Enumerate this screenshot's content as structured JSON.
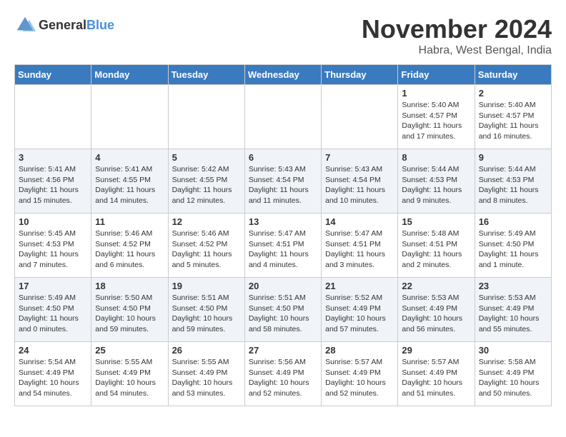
{
  "header": {
    "logo_general": "General",
    "logo_blue": "Blue",
    "month": "November 2024",
    "location": "Habra, West Bengal, India"
  },
  "weekdays": [
    "Sunday",
    "Monday",
    "Tuesday",
    "Wednesday",
    "Thursday",
    "Friday",
    "Saturday"
  ],
  "weeks": [
    [
      {
        "day": "",
        "content": ""
      },
      {
        "day": "",
        "content": ""
      },
      {
        "day": "",
        "content": ""
      },
      {
        "day": "",
        "content": ""
      },
      {
        "day": "",
        "content": ""
      },
      {
        "day": "1",
        "content": "Sunrise: 5:40 AM\nSunset: 4:57 PM\nDaylight: 11 hours and 17 minutes."
      },
      {
        "day": "2",
        "content": "Sunrise: 5:40 AM\nSunset: 4:57 PM\nDaylight: 11 hours and 16 minutes."
      }
    ],
    [
      {
        "day": "3",
        "content": "Sunrise: 5:41 AM\nSunset: 4:56 PM\nDaylight: 11 hours and 15 minutes."
      },
      {
        "day": "4",
        "content": "Sunrise: 5:41 AM\nSunset: 4:55 PM\nDaylight: 11 hours and 14 minutes."
      },
      {
        "day": "5",
        "content": "Sunrise: 5:42 AM\nSunset: 4:55 PM\nDaylight: 11 hours and 12 minutes."
      },
      {
        "day": "6",
        "content": "Sunrise: 5:43 AM\nSunset: 4:54 PM\nDaylight: 11 hours and 11 minutes."
      },
      {
        "day": "7",
        "content": "Sunrise: 5:43 AM\nSunset: 4:54 PM\nDaylight: 11 hours and 10 minutes."
      },
      {
        "day": "8",
        "content": "Sunrise: 5:44 AM\nSunset: 4:53 PM\nDaylight: 11 hours and 9 minutes."
      },
      {
        "day": "9",
        "content": "Sunrise: 5:44 AM\nSunset: 4:53 PM\nDaylight: 11 hours and 8 minutes."
      }
    ],
    [
      {
        "day": "10",
        "content": "Sunrise: 5:45 AM\nSunset: 4:53 PM\nDaylight: 11 hours and 7 minutes."
      },
      {
        "day": "11",
        "content": "Sunrise: 5:46 AM\nSunset: 4:52 PM\nDaylight: 11 hours and 6 minutes."
      },
      {
        "day": "12",
        "content": "Sunrise: 5:46 AM\nSunset: 4:52 PM\nDaylight: 11 hours and 5 minutes."
      },
      {
        "day": "13",
        "content": "Sunrise: 5:47 AM\nSunset: 4:51 PM\nDaylight: 11 hours and 4 minutes."
      },
      {
        "day": "14",
        "content": "Sunrise: 5:47 AM\nSunset: 4:51 PM\nDaylight: 11 hours and 3 minutes."
      },
      {
        "day": "15",
        "content": "Sunrise: 5:48 AM\nSunset: 4:51 PM\nDaylight: 11 hours and 2 minutes."
      },
      {
        "day": "16",
        "content": "Sunrise: 5:49 AM\nSunset: 4:50 PM\nDaylight: 11 hours and 1 minute."
      }
    ],
    [
      {
        "day": "17",
        "content": "Sunrise: 5:49 AM\nSunset: 4:50 PM\nDaylight: 11 hours and 0 minutes."
      },
      {
        "day": "18",
        "content": "Sunrise: 5:50 AM\nSunset: 4:50 PM\nDaylight: 10 hours and 59 minutes."
      },
      {
        "day": "19",
        "content": "Sunrise: 5:51 AM\nSunset: 4:50 PM\nDaylight: 10 hours and 59 minutes."
      },
      {
        "day": "20",
        "content": "Sunrise: 5:51 AM\nSunset: 4:50 PM\nDaylight: 10 hours and 58 minutes."
      },
      {
        "day": "21",
        "content": "Sunrise: 5:52 AM\nSunset: 4:49 PM\nDaylight: 10 hours and 57 minutes."
      },
      {
        "day": "22",
        "content": "Sunrise: 5:53 AM\nSunset: 4:49 PM\nDaylight: 10 hours and 56 minutes."
      },
      {
        "day": "23",
        "content": "Sunrise: 5:53 AM\nSunset: 4:49 PM\nDaylight: 10 hours and 55 minutes."
      }
    ],
    [
      {
        "day": "24",
        "content": "Sunrise: 5:54 AM\nSunset: 4:49 PM\nDaylight: 10 hours and 54 minutes."
      },
      {
        "day": "25",
        "content": "Sunrise: 5:55 AM\nSunset: 4:49 PM\nDaylight: 10 hours and 54 minutes."
      },
      {
        "day": "26",
        "content": "Sunrise: 5:55 AM\nSunset: 4:49 PM\nDaylight: 10 hours and 53 minutes."
      },
      {
        "day": "27",
        "content": "Sunrise: 5:56 AM\nSunset: 4:49 PM\nDaylight: 10 hours and 52 minutes."
      },
      {
        "day": "28",
        "content": "Sunrise: 5:57 AM\nSunset: 4:49 PM\nDaylight: 10 hours and 52 minutes."
      },
      {
        "day": "29",
        "content": "Sunrise: 5:57 AM\nSunset: 4:49 PM\nDaylight: 10 hours and 51 minutes."
      },
      {
        "day": "30",
        "content": "Sunrise: 5:58 AM\nSunset: 4:49 PM\nDaylight: 10 hours and 50 minutes."
      }
    ]
  ]
}
